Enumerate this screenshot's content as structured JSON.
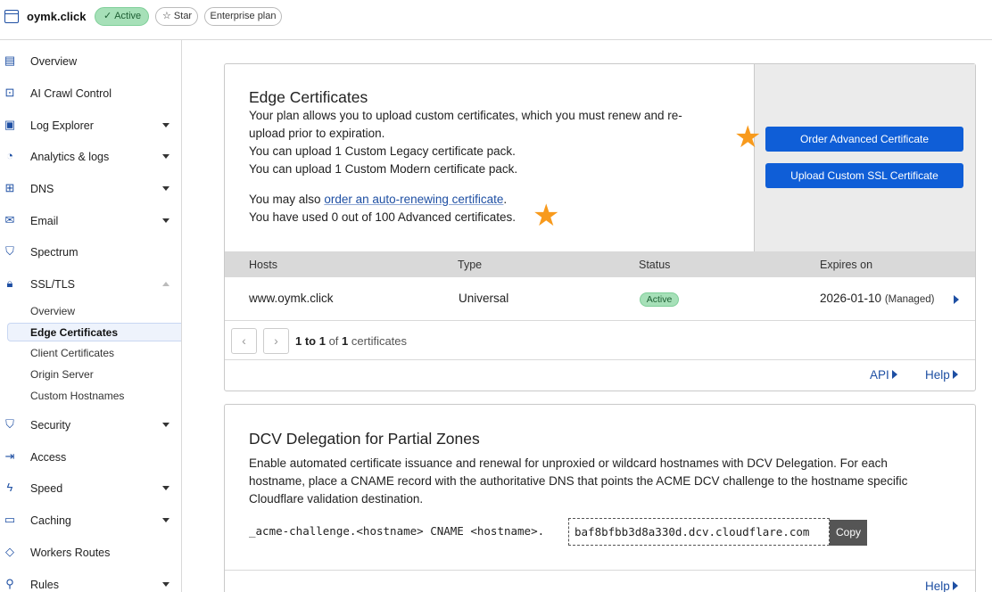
{
  "topbar": {
    "zone_name": "oymk.click",
    "status": "Active",
    "star_label": "Star",
    "plan": "Enterprise plan"
  },
  "sidebar": {
    "items": [
      {
        "label": "Overview",
        "icon": "document-icon"
      },
      {
        "label": "AI Crawl Control",
        "icon": "robot-icon"
      },
      {
        "label": "Log Explorer",
        "icon": "log-icon"
      },
      {
        "label": "Analytics & logs",
        "icon": "chart-icon"
      },
      {
        "label": "DNS",
        "icon": "network-icon"
      },
      {
        "label": "Email",
        "icon": "mail-icon"
      },
      {
        "label": "Spectrum",
        "icon": "shield-icon"
      },
      {
        "label": "SSL/TLS",
        "icon": "lock-icon"
      },
      {
        "label": "Security",
        "icon": "shield-icon"
      },
      {
        "label": "Access",
        "icon": "access-icon"
      },
      {
        "label": "Speed",
        "icon": "bolt-icon"
      },
      {
        "label": "Caching",
        "icon": "drive-icon"
      },
      {
        "label": "Workers Routes",
        "icon": "diamond-icon"
      },
      {
        "label": "Rules",
        "icon": "filter-icon"
      }
    ],
    "ssl_subitems": [
      "Overview",
      "Edge Certificates",
      "Client Certificates",
      "Origin Server",
      "Custom Hostnames"
    ]
  },
  "edge": {
    "title": "Edge Certificates",
    "para1_line1": "Your plan allows you to upload custom certificates, which you must renew and re-",
    "para1_line2": "upload prior to expiration.",
    "para1_line3": "You can upload 1 Custom Legacy certificate pack.",
    "para1_line4": "You can upload 1 Custom Modern certificate pack.",
    "para2_prefix": "You may also ",
    "para2_link": "order an auto-renewing certificate",
    "para2_suffix": ".",
    "para2_line2": "You have used 0 out of 100 Advanced certificates.",
    "btn_order": "Order Advanced Certificate",
    "btn_upload": "Upload Custom SSL Certificate",
    "table": {
      "headers": [
        "Hosts",
        "Type",
        "Status",
        "Expires on"
      ],
      "row": {
        "host": "www.oymk.click",
        "type": "Universal",
        "status": "Active",
        "expires": "2026-01-10",
        "note": "(Managed)"
      }
    },
    "pager": {
      "range_start": "1",
      "to": " to ",
      "range_end": "1",
      "of": " of ",
      "total": "1",
      "suffix": " certificates",
      "prev": "‹",
      "next": "›"
    },
    "api_link": "API",
    "help_link": "Help"
  },
  "dcv": {
    "title": "DCV Delegation for Partial Zones",
    "line1": "Enable automated certificate issuance and renewal for unproxied or wildcard hostnames with DCV Delegation. For each",
    "line2": "hostname, place a CNAME record with the authoritative DNS that points the ACME DCV challenge to the hostname specific",
    "line3": "Cloudflare validation destination.",
    "cname_prefix": "_acme-challenge.<hostname> CNAME <hostname>.",
    "cname_target": "baf8bfbb3d8a330d.dcv.cloudflare.com",
    "copy_label": "Copy",
    "help_link": "Help"
  },
  "colors": {
    "accent": "#0f5ed7",
    "link": "#1e4fa3",
    "active_badge": "#a6e0b8",
    "star": "#f89a1c"
  }
}
